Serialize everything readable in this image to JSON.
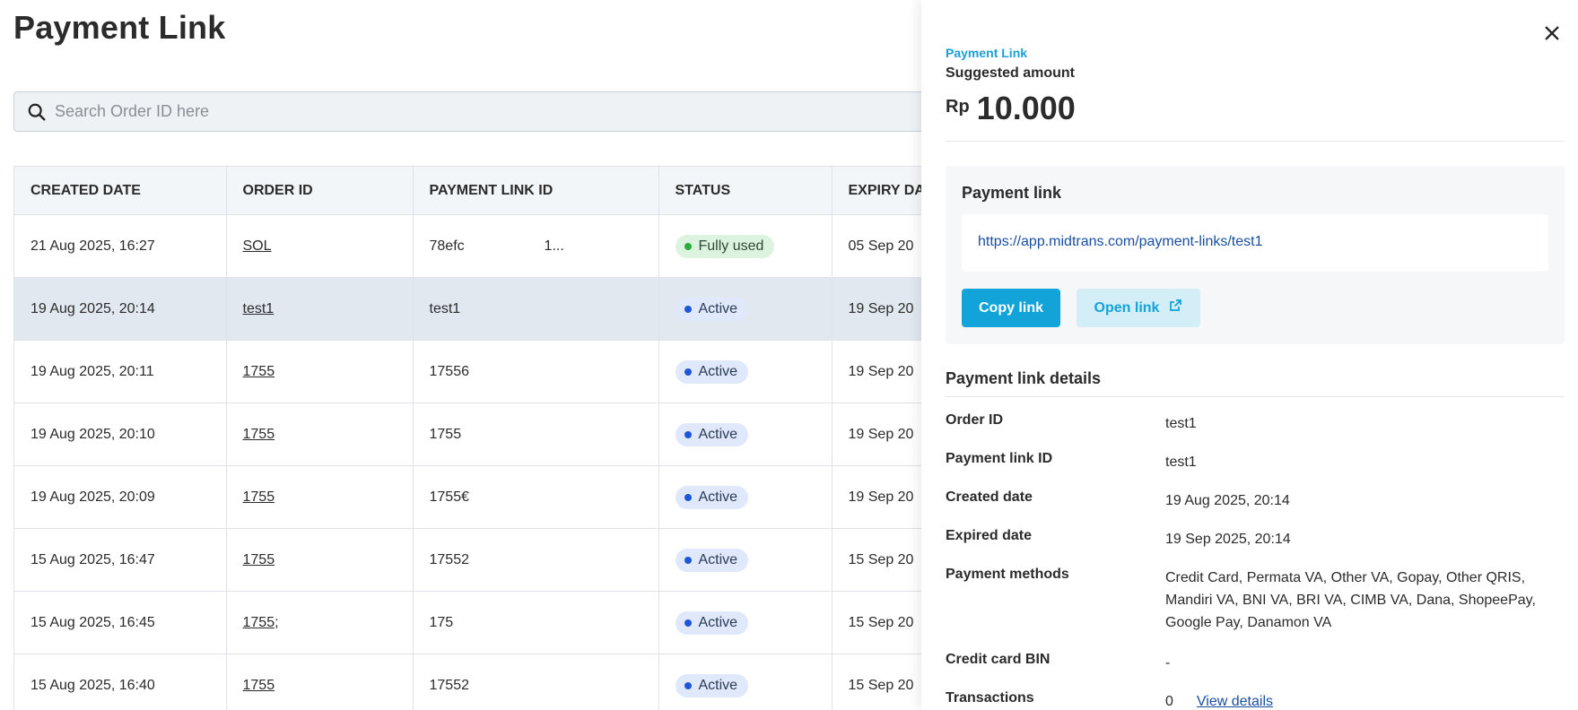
{
  "page": {
    "title": "Payment Link"
  },
  "search": {
    "placeholder": "Search Order ID here"
  },
  "table": {
    "columns": [
      "CREATED DATE",
      "ORDER ID",
      "PAYMENT LINK ID",
      "STATUS",
      "EXPIRY DA"
    ],
    "rows": [
      {
        "created": "21 Aug 2025, 16:27",
        "order_id": "SOL",
        "payment_link_id": "78efc                    1...",
        "status": "Fully used",
        "expiry": "05 Sep 20"
      },
      {
        "created": "19 Aug 2025, 20:14",
        "order_id": "test1",
        "payment_link_id": "test1",
        "status": "Active",
        "expiry": "19 Sep 20"
      },
      {
        "created": "19 Aug 2025, 20:11",
        "order_id": "1755",
        "payment_link_id": "17556",
        "status": "Active",
        "expiry": "19 Sep 20"
      },
      {
        "created": "19 Aug 2025, 20:10",
        "order_id": "1755",
        "payment_link_id": "1755",
        "status": "Active",
        "expiry": "19 Sep 20"
      },
      {
        "created": "19 Aug 2025, 20:09",
        "order_id": "1755",
        "payment_link_id": "1755€",
        "status": "Active",
        "expiry": "19 Sep 20"
      },
      {
        "created": "15 Aug 2025, 16:47",
        "order_id": "1755",
        "payment_link_id": "17552",
        "status": "Active",
        "expiry": "15 Sep 20"
      },
      {
        "created": "15 Aug 2025, 16:45",
        "order_id": "1755;",
        "payment_link_id": "175",
        "status": "Active",
        "expiry": "15 Sep 20"
      },
      {
        "created": "15 Aug 2025, 16:40",
        "order_id": "1755",
        "payment_link_id": "17552",
        "status": "Active",
        "expiry": "15 Sep 20"
      }
    ]
  },
  "panel": {
    "eyebrow": "Payment Link",
    "suggested_label": "Suggested amount",
    "currency": "Rp",
    "amount": "10.000",
    "link_card": {
      "title": "Payment link",
      "url": "https://app.midtrans.com/payment-links/test1",
      "copy_label": "Copy link",
      "open_label": "Open link"
    },
    "details_title": "Payment link details",
    "details": {
      "order_id": {
        "label": "Order ID",
        "value": "test1"
      },
      "payment_link_id": {
        "label": "Payment link ID",
        "value": "test1"
      },
      "created_date": {
        "label": "Created date",
        "value": "19 Aug 2025, 20:14"
      },
      "expired_date": {
        "label": "Expired date",
        "value": "19 Sep 2025, 20:14"
      },
      "payment_methods": {
        "label": "Payment methods",
        "value": "Credit Card, Permata VA, Other VA, Gopay, Other QRIS, Mandiri VA, BNI VA, BRI VA, CIMB VA, Dana, ShopeePay, Google Pay, Danamon VA"
      },
      "credit_card_bin": {
        "label": "Credit card BIN",
        "value": "-"
      },
      "transactions": {
        "label": "Transactions",
        "value": "0",
        "link": "View details"
      }
    }
  },
  "colors": {
    "accent": "#12a3d8",
    "link": "#1a4fa0",
    "active_dot": "#1d56d6",
    "used_dot": "#2bab3e",
    "selected_row": "#e1e8f0"
  },
  "icons": {
    "search": "search-icon",
    "close": "close-icon",
    "external": "external-link-icon"
  }
}
